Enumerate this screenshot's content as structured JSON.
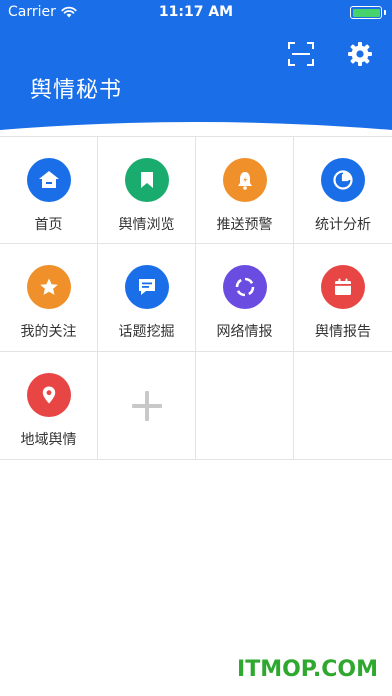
{
  "status_bar": {
    "carrier": "Carrier",
    "time": "11:17 AM"
  },
  "header": {
    "title": "舆情秘书",
    "background": "#1a6fe8"
  },
  "grid": [
    {
      "name": "grid-item-home",
      "label": "首页",
      "icon": "home-icon",
      "color": "#1a6fe8"
    },
    {
      "name": "grid-item-browse",
      "label": "舆情浏览",
      "icon": "bookmark-icon",
      "color": "#1aab6e"
    },
    {
      "name": "grid-item-alert",
      "label": "推送预警",
      "icon": "bell-icon",
      "color": "#f0902a"
    },
    {
      "name": "grid-item-stats",
      "label": "统计分析",
      "icon": "pie-chart-icon",
      "color": "#1a6fe8"
    },
    {
      "name": "grid-item-follow",
      "label": "我的关注",
      "icon": "star-icon",
      "color": "#f0902a"
    },
    {
      "name": "grid-item-topic",
      "label": "话题挖掘",
      "icon": "message-icon",
      "color": "#1a6fe8"
    },
    {
      "name": "grid-item-web",
      "label": "网络情报",
      "icon": "circle-dashed-icon",
      "color": "#6b4ce0"
    },
    {
      "name": "grid-item-report",
      "label": "舆情报告",
      "icon": "calendar-icon",
      "color": "#e84545"
    },
    {
      "name": "grid-item-region",
      "label": "地域舆情",
      "icon": "location-pin-icon",
      "color": "#e84545"
    }
  ],
  "watermark": "ITMOP.COM"
}
